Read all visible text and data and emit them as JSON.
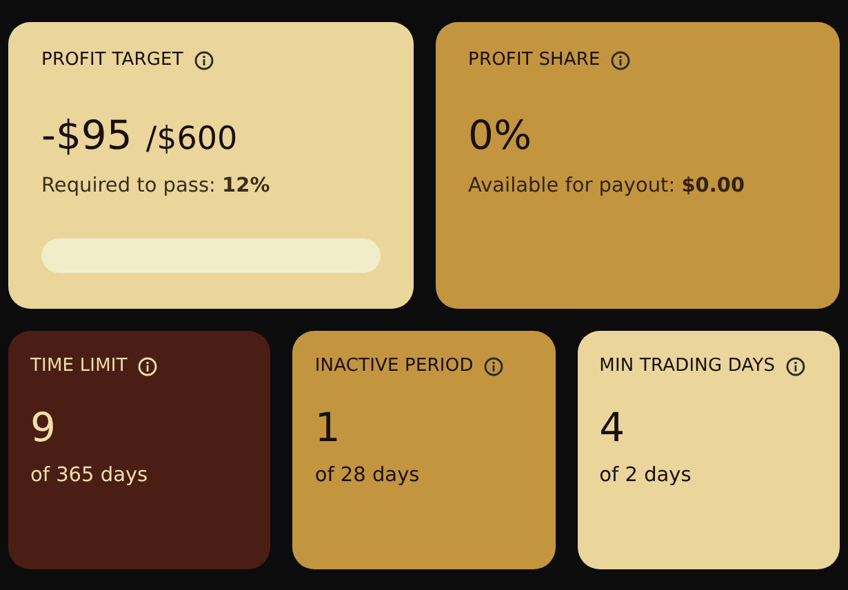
{
  "top_cards": [
    {
      "title": "PROFIT TARGET",
      "color": "#ead59a",
      "value": "-$95",
      "target": "/$600",
      "note": "Required to pass: **12%**",
      "kind": "progress"
    },
    {
      "title": "PROFIT SHARE",
      "color": "#c3953e",
      "value": "0%",
      "note": "Available for payout: **$0.00**",
      "kind": "plain"
    }
  ],
  "bottom_cards": [
    {
      "title": "TIME LIMIT",
      "color": "#4a1d15",
      "value": "9",
      "note": "of 365 days"
    },
    {
      "title": "INACTIVE PERIOD",
      "color": "#c3953e",
      "value": "1",
      "note": "of 28 days"
    },
    {
      "title": "MIN TRADING DAYS",
      "color": "#ead59a",
      "value": "4",
      "note": "of 2 days"
    }
  ]
}
